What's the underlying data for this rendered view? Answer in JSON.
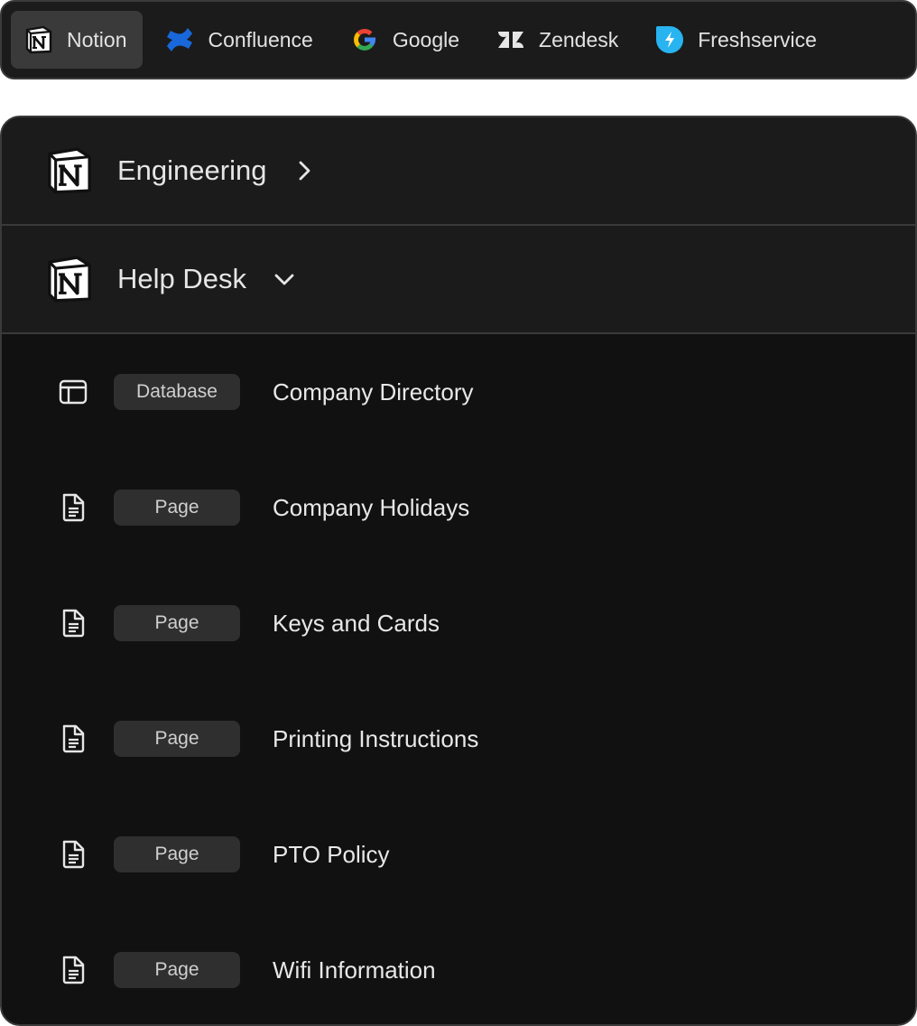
{
  "sources": [
    {
      "label": "Notion",
      "icon": "notion-icon",
      "active": true
    },
    {
      "label": "Confluence",
      "icon": "confluence-icon",
      "active": false
    },
    {
      "label": "Google",
      "icon": "google-icon",
      "active": false
    },
    {
      "label": "Zendesk",
      "icon": "zendesk-icon",
      "active": false
    },
    {
      "label": "Freshservice",
      "icon": "freshservice-icon",
      "active": false
    }
  ],
  "workspaces": [
    {
      "label": "Engineering",
      "icon": "notion-icon",
      "state": "collapsed"
    },
    {
      "label": "Help Desk",
      "icon": "notion-icon",
      "state": "expanded"
    }
  ],
  "items": [
    {
      "type": "Database",
      "icon": "database-icon",
      "title": "Company Directory"
    },
    {
      "type": "Page",
      "icon": "page-icon",
      "title": "Company Holidays"
    },
    {
      "type": "Page",
      "icon": "page-icon",
      "title": "Keys and Cards"
    },
    {
      "type": "Page",
      "icon": "page-icon",
      "title": "Printing Instructions"
    },
    {
      "type": "Page",
      "icon": "page-icon",
      "title": "PTO Policy"
    },
    {
      "type": "Page",
      "icon": "page-icon",
      "title": "Wifi Information"
    }
  ],
  "colors": {
    "background": "#111111",
    "surface": "#1b1b1b",
    "border": "#3a3a3a",
    "badge": "#2f2f2f",
    "text": "#e8e8e8",
    "confluence_blue": "#1868db",
    "freshservice_blue": "#28b4f0"
  }
}
